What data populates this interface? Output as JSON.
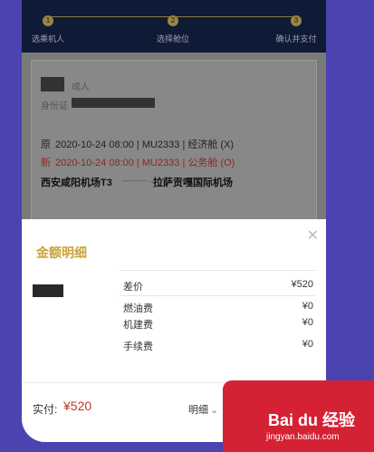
{
  "stepper": {
    "steps": [
      {
        "num": "1",
        "label": "选乘机人"
      },
      {
        "num": "2",
        "label": "选择舱位"
      },
      {
        "num": "3",
        "label": "确认并支付"
      }
    ]
  },
  "passenger": {
    "name_suffix": "成人",
    "id_label": "身份证"
  },
  "flight": {
    "original_prefix": "原",
    "original_text": "2020-10-24 08:00 | MU2333 | 经济舱 (X)",
    "new_prefix": "新",
    "new_text": "2020-10-24 08:00 | MU2333 | 公务舱 (O)",
    "from": "西安咸阳机场T3",
    "to": "拉萨贡嘎国际机场"
  },
  "sheet": {
    "title": "金额明细",
    "rows": [
      {
        "label": "差价",
        "value": "¥520"
      },
      {
        "label": "燃油费",
        "value": "¥0"
      },
      {
        "label": "机建费",
        "value": "¥0"
      },
      {
        "label": "手续费",
        "value": "¥0"
      }
    ]
  },
  "footer": {
    "paid_label": "实付:",
    "paid_value": "¥520",
    "detail_label": "明细"
  },
  "watermark": {
    "logo": "Bai du 经验",
    "url": "jingyan.baidu.com"
  },
  "colors": {
    "accent": "#c9a23a",
    "price": "#c0392b",
    "background": "#4a43b0",
    "header": "#0f1a36"
  }
}
